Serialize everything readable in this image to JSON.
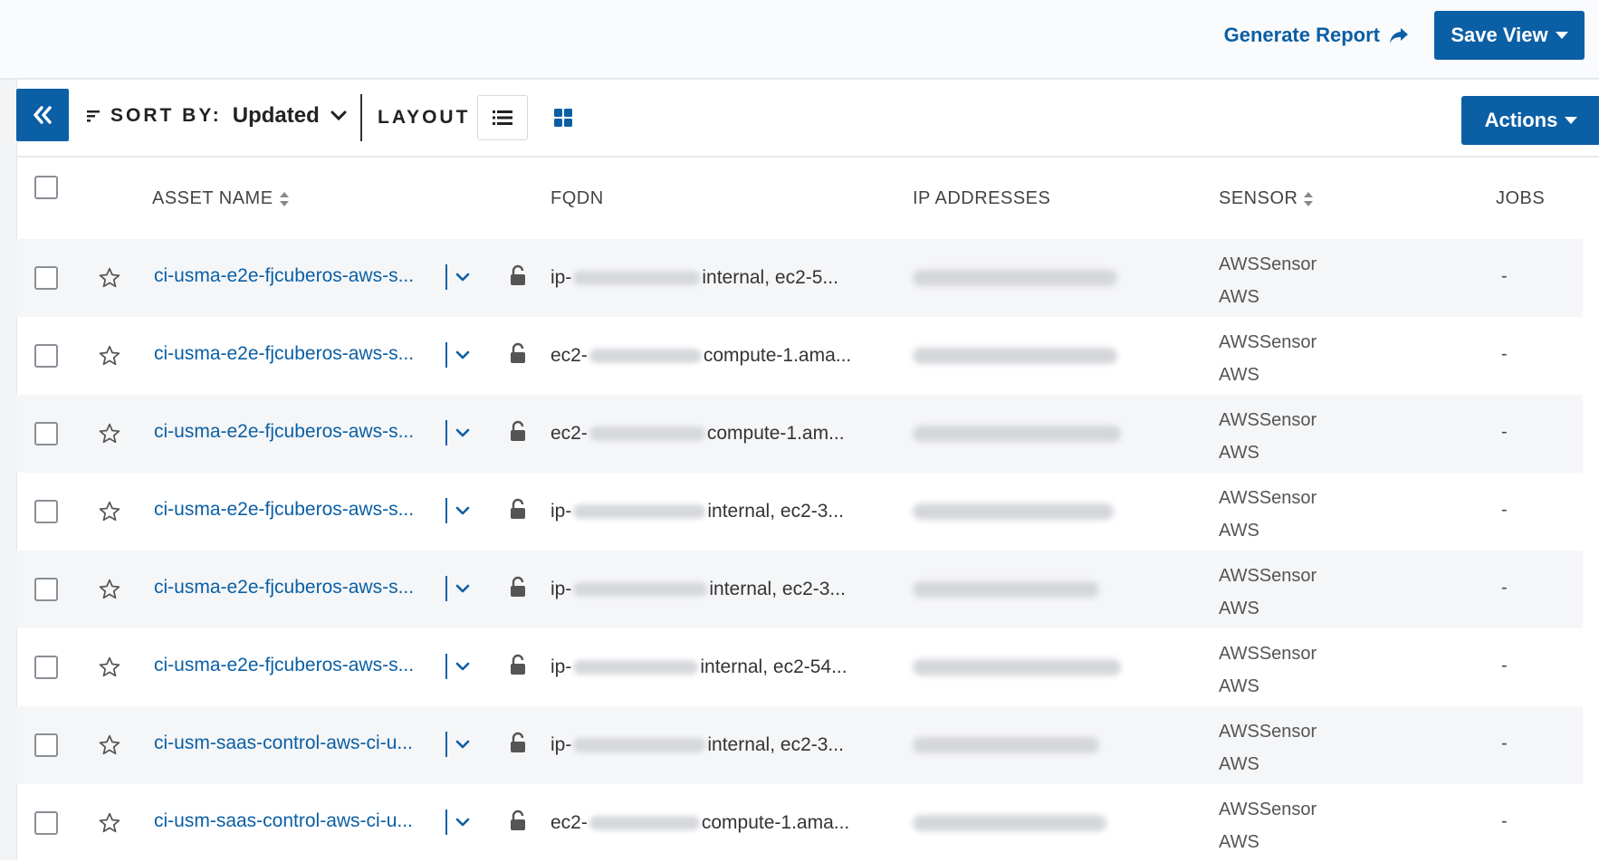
{
  "header": {
    "generate_report": "Generate Report",
    "save_view": "Save View"
  },
  "toolbar": {
    "sort_label": "SORT BY:",
    "sort_value": "Updated",
    "layout_label": "LAYOUT",
    "actions": "Actions"
  },
  "columns": {
    "asset_name": "ASSET NAME",
    "fqdn": "FQDN",
    "ip_addresses": "IP ADDRESSES",
    "sensor": "SENSOR",
    "jobs": "JOBS"
  },
  "rows": [
    {
      "name": "ci-usma-e2e-fjcuberos-aws-s...",
      "fqdn_prefix": "ip-",
      "fqdn_suffix": "internal, ec2-5...",
      "sensor": "AWSSensor",
      "type": "AWS",
      "jobs": "-"
    },
    {
      "name": "ci-usma-e2e-fjcuberos-aws-s...",
      "fqdn_prefix": "ec2-",
      "fqdn_suffix": "compute-1.ama...",
      "sensor": "AWSSensor",
      "type": "AWS",
      "jobs": "-"
    },
    {
      "name": "ci-usma-e2e-fjcuberos-aws-s...",
      "fqdn_prefix": "ec2-",
      "fqdn_suffix": "compute-1.am...",
      "sensor": "AWSSensor",
      "type": "AWS",
      "jobs": "-"
    },
    {
      "name": "ci-usma-e2e-fjcuberos-aws-s...",
      "fqdn_prefix": "ip-",
      "fqdn_suffix": "internal, ec2-3...",
      "sensor": "AWSSensor",
      "type": "AWS",
      "jobs": "-"
    },
    {
      "name": "ci-usma-e2e-fjcuberos-aws-s...",
      "fqdn_prefix": "ip-",
      "fqdn_suffix": "internal, ec2-3...",
      "sensor": "AWSSensor",
      "type": "AWS",
      "jobs": "-"
    },
    {
      "name": "ci-usma-e2e-fjcuberos-aws-s...",
      "fqdn_prefix": "ip-",
      "fqdn_suffix": "internal, ec2-54...",
      "sensor": "AWSSensor",
      "type": "AWS",
      "jobs": "-"
    },
    {
      "name": "ci-usm-saas-control-aws-ci-u...",
      "fqdn_prefix": "ip-",
      "fqdn_suffix": "internal, ec2-3...",
      "sensor": "AWSSensor",
      "type": "AWS",
      "jobs": "-"
    },
    {
      "name": "ci-usm-saas-control-aws-ci-u...",
      "fqdn_prefix": "ec2-",
      "fqdn_suffix": "compute-1.ama...",
      "sensor": "AWSSensor",
      "type": "AWS",
      "jobs": "-"
    }
  ],
  "colors": {
    "accent": "#0b5fa5",
    "link": "#0a5fa5",
    "row_alt": "#f5f6f8"
  },
  "icons": {
    "generate_report": "share-arrow-icon",
    "collapse": "double-chevron-left-icon",
    "sort": "sort-lines-icon",
    "sort_dropdown": "chevron-down-icon",
    "layout_list": "list-icon",
    "layout_grid": "grid-icon",
    "favorite": "star-outline-icon",
    "row_menu": "chevron-down-icon",
    "lock": "unlocked-lock-icon",
    "column_sort": "sort-arrows-icon"
  }
}
